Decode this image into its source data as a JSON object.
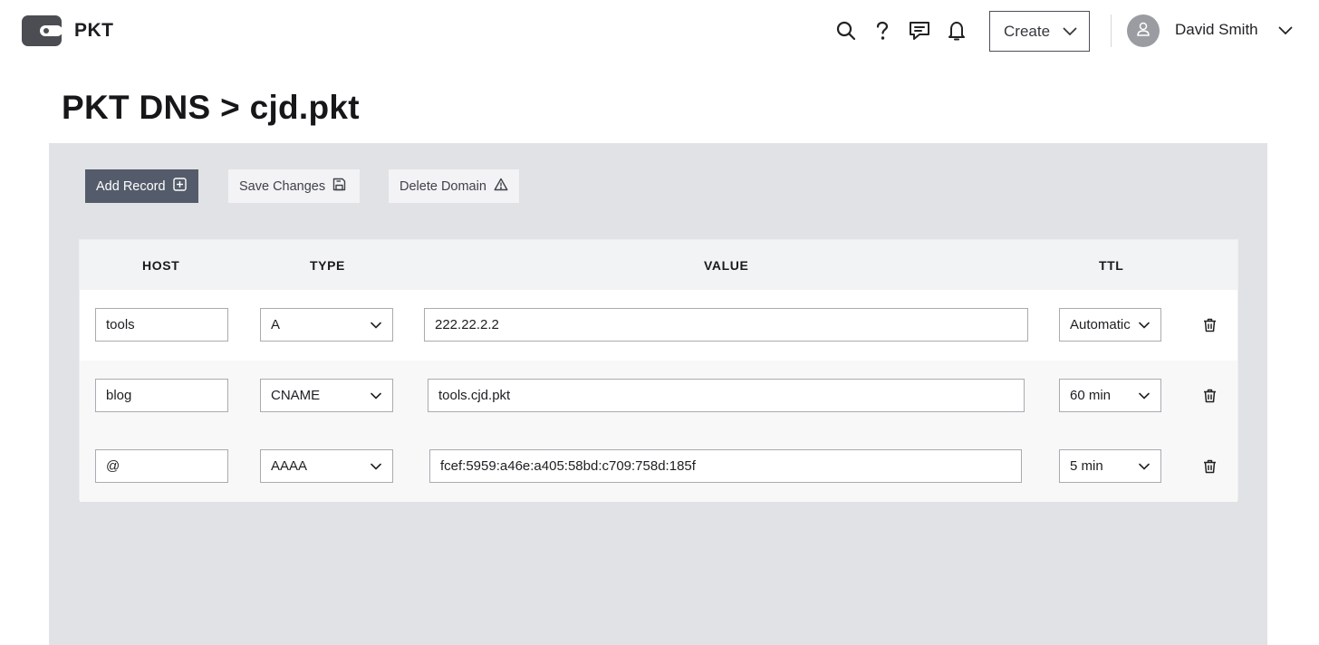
{
  "header": {
    "brand": "PKT",
    "create_label": "Create",
    "user_name": "David Smith",
    "icons": [
      "search-icon",
      "help-icon",
      "chat-icon",
      "bell-icon",
      "chevron-down-icon",
      "user-icon"
    ]
  },
  "page": {
    "title": "PKT DNS > cjd.pkt"
  },
  "toolbar": {
    "add_record_label": "Add Record",
    "save_changes_label": "Save Changes",
    "delete_domain_label": "Delete Domain"
  },
  "table": {
    "columns": [
      "HOST",
      "TYPE",
      "VALUE",
      "TTL"
    ],
    "rows": [
      {
        "host": "tools",
        "type": "A",
        "value": "222.22.2.2",
        "ttl": "Automatic"
      },
      {
        "host": "blog",
        "type": "CNAME",
        "value": "tools.cjd.pkt",
        "ttl": "60 min"
      },
      {
        "host": "@",
        "type": "AAAA",
        "value": "fcef:5959:a46e:a405:58bd:c709:758d:185f",
        "ttl": "5 min"
      }
    ]
  },
  "colors": {
    "primary_button": "#545c6b",
    "panel_background": "#e1e2e5",
    "table_header": "#f2f3f5"
  }
}
